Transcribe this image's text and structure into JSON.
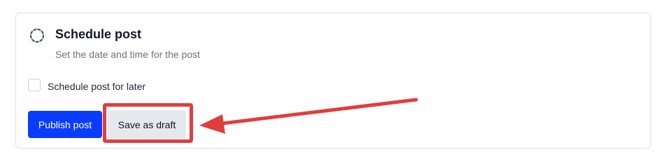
{
  "card": {
    "title": "Schedule post",
    "subtitle": "Set the date and time for the post",
    "icon": "loading-dashed-circle-icon"
  },
  "schedule_checkbox": {
    "label": "Schedule post for later",
    "checked": false
  },
  "buttons": {
    "publish_label": "Publish post",
    "draft_label": "Save as draft"
  },
  "annotation": {
    "color": "#e23d3d",
    "target": "save-as-draft-button"
  },
  "colors": {
    "primary": "#0a3cff",
    "secondary_bg": "#e5e8ec",
    "muted_text": "#6b7280"
  }
}
